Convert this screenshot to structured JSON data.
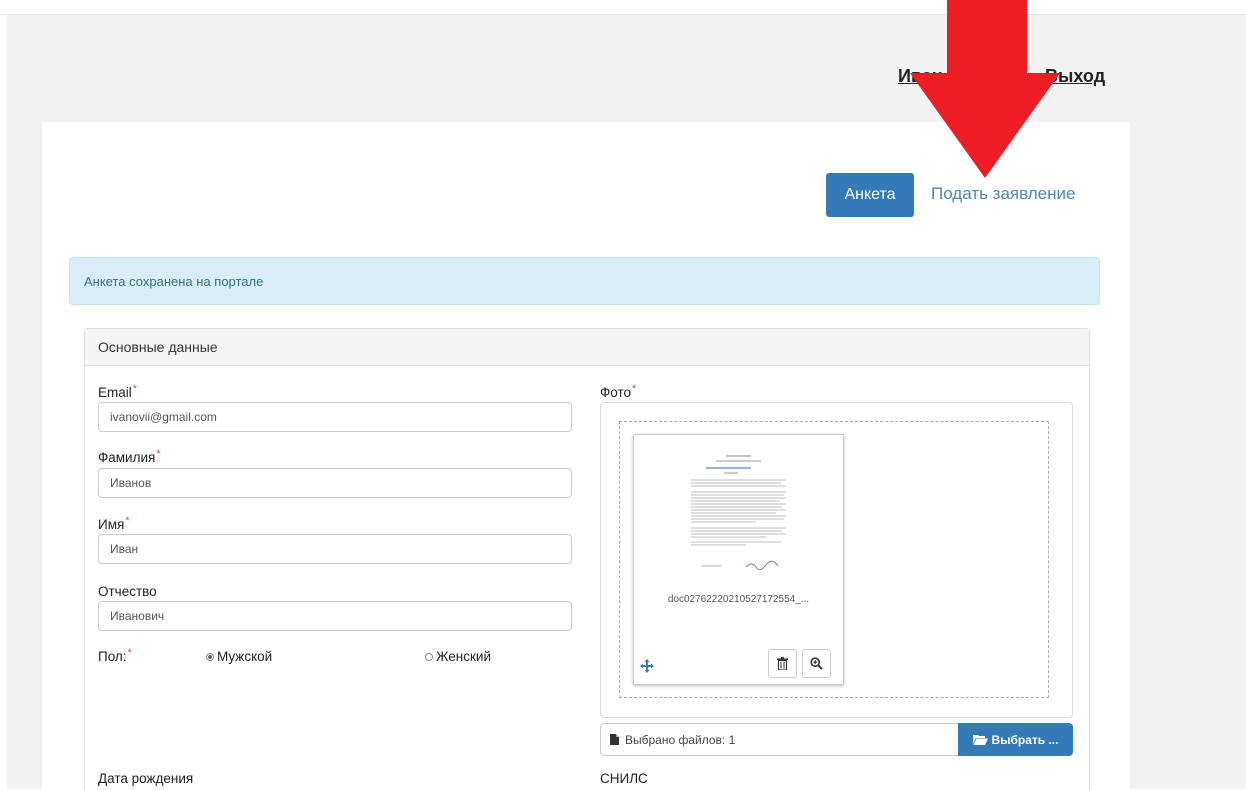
{
  "header": {
    "user_name": "Иван",
    "logout_label": "Выход"
  },
  "nav": {
    "anketa_label": "Анкета",
    "apply_label": "Подать заявление"
  },
  "alert": {
    "message": "Анкета сохранена на портале"
  },
  "panel": {
    "title": "Основные данные"
  },
  "form": {
    "email_label": "Email",
    "email_value": "ivanovii@gmail.com",
    "lastname_label": "Фамилия",
    "lastname_value": "Иванов",
    "firstname_label": "Имя",
    "firstname_value": "Иван",
    "patronymic_label": "Отчество",
    "patronymic_value": "Иванович",
    "gender_label": "Пол:",
    "gender_male": "Мужской",
    "gender_female": "Женский",
    "gender_selected": "Мужской",
    "birthdate_label": "Дата рождения",
    "required_mark": "*"
  },
  "photo": {
    "label": "Фото",
    "file_name": "doc02762220210527172554_...",
    "files_selected": "Выбрано файлов: 1",
    "choose_label": "Выбрать ..."
  },
  "snils": {
    "label": "СНИЛС"
  },
  "colors": {
    "primary": "#337ab7",
    "link": "#4a86c5",
    "alert_bg": "#d9edf7",
    "alert_text": "#31708f",
    "arrow": "#ee1c25",
    "required": "#d9534f"
  }
}
